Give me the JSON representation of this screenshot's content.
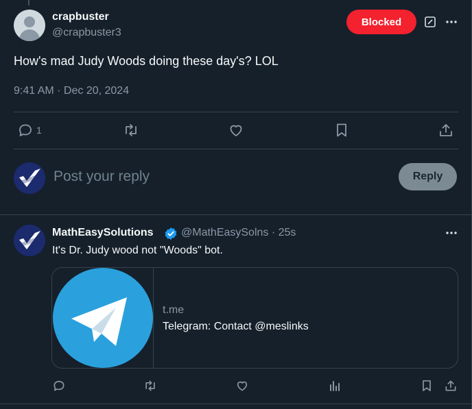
{
  "main_tweet": {
    "display_name": "crapbuster",
    "handle": "@crapbuster3",
    "blocked_label": "Blocked",
    "text": "How's mad Judy Woods doing these day's? LOL",
    "timestamp": "9:41 AM · Dec 20, 2024",
    "actions": {
      "reply_count": "1"
    }
  },
  "composer": {
    "placeholder": "Post your reply",
    "reply_button": "Reply"
  },
  "reply_tweet": {
    "display_name": "MathEasySolutions",
    "handle_time": "@MathEasySolns · 25s",
    "text": "It's Dr. Judy wood not \"Woods\" bot.",
    "card": {
      "domain": "t.me",
      "title": "Telegram: Contact @meslinks"
    }
  },
  "colors": {
    "background": "#15202b",
    "blocked": "#f4212e",
    "verified": "#1d9bf0",
    "telegram": "#2aa1dd"
  },
  "icons": [
    "more-icon",
    "edit-icon",
    "reply-icon",
    "repost-icon",
    "like-icon",
    "bookmark-icon",
    "share-icon",
    "views-icon",
    "verified-icon",
    "telegram-icon"
  ]
}
